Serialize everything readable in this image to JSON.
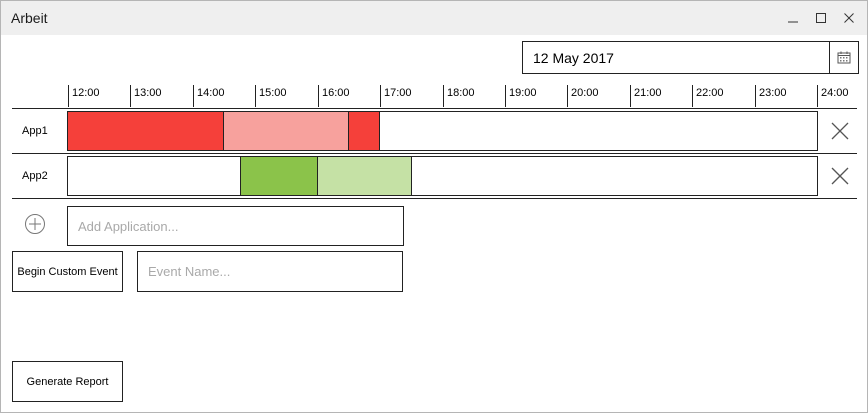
{
  "window": {
    "title": "Arbeit"
  },
  "date_picker": {
    "value": "12 May 2017"
  },
  "timeline": {
    "ticks": [
      "12:00",
      "13:00",
      "14:00",
      "15:00",
      "16:00",
      "17:00",
      "18:00",
      "19:00",
      "20:00",
      "21:00",
      "22:00",
      "23:00",
      "24:00"
    ]
  },
  "apps": [
    {
      "name": "App1",
      "segments": [
        {
          "start": "12:00",
          "end": "14:30",
          "color": "#f5403a"
        },
        {
          "start": "14:30",
          "end": "16:30",
          "color": "#f7a19d"
        },
        {
          "start": "16:30",
          "end": "17:00",
          "color": "#f5403a"
        }
      ]
    },
    {
      "name": "App2",
      "segments": [
        {
          "start": "14:45",
          "end": "16:00",
          "color": "#8bc34a"
        },
        {
          "start": "16:00",
          "end": "17:30",
          "color": "#c5e1a5"
        }
      ]
    }
  ],
  "add_application": {
    "placeholder": "Add Application..."
  },
  "custom_event": {
    "button_label": "Begin Custom Event",
    "placeholder": "Event Name..."
  },
  "report": {
    "button_label": "Generate Report"
  },
  "icons": {
    "minimize": "minimize-icon",
    "maximize": "maximize-icon",
    "close": "close-icon",
    "calendar": "calendar-icon",
    "remove": "remove-icon",
    "add": "add-circle-icon"
  }
}
